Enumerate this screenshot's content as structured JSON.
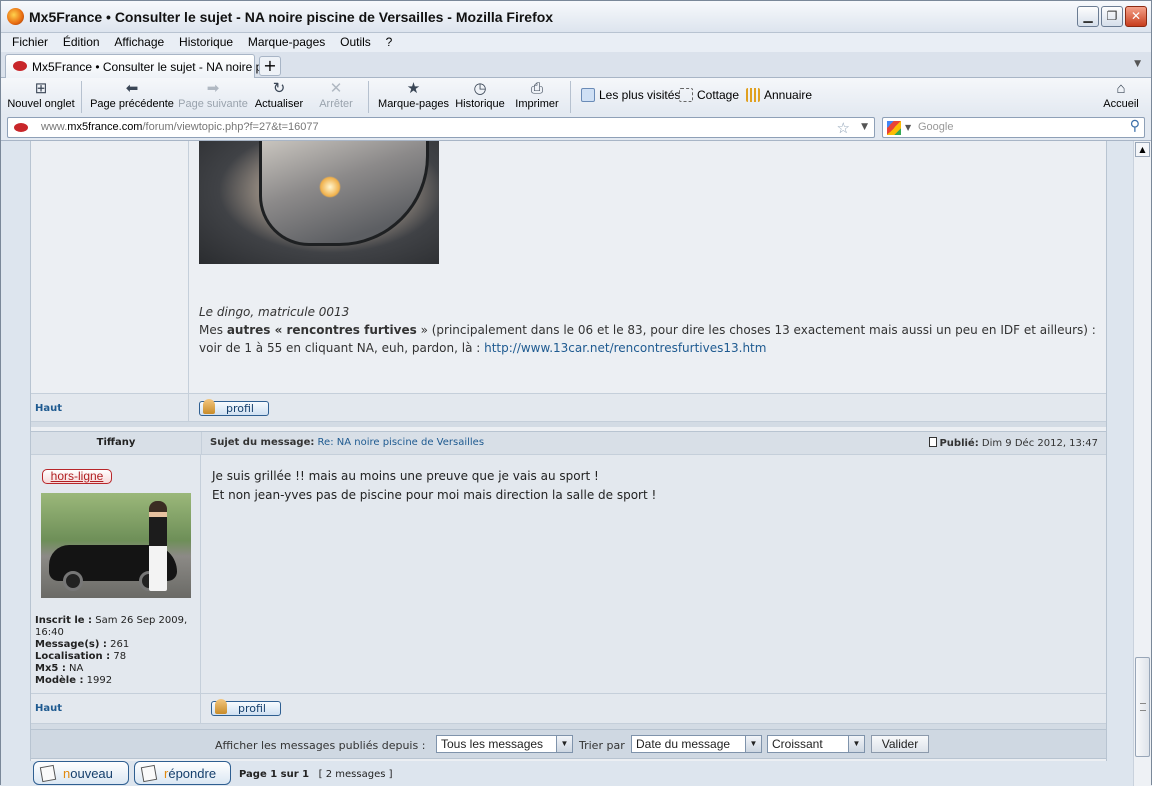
{
  "window": {
    "title": "Mx5France • Consulter le sujet - NA noire piscine de Versailles - Mozilla Firefox"
  },
  "menu": [
    "Fichier",
    "Édition",
    "Affichage",
    "Historique",
    "Marque-pages",
    "Outils",
    "?"
  ],
  "tab": {
    "label": "Mx5France • Consulter le sujet - NA noire pi..."
  },
  "nav": {
    "new_tab": "Nouvel onglet",
    "back": "Page précédente",
    "forward": "Page suivante",
    "reload": "Actualiser",
    "stop": "Arrêter",
    "bookmarks": "Marque-pages",
    "history": "Historique",
    "print": "Imprimer",
    "most_visited": "Les plus visités",
    "cottage": "Cottage",
    "annuaire": "Annuaire",
    "home": "Accueil"
  },
  "urlbar": {
    "prefix": "www.",
    "domain": "mx5france.com",
    "path": "/forum/viewtopic.php?f=27&t=16077"
  },
  "search": {
    "placeholder": "Google"
  },
  "post1": {
    "signature_name": "Le dingo, matricule 0013",
    "sig_prefix": "Mes ",
    "sig_bold": "autres « rencontres furtives",
    "sig_rest": " » (principalement dans le 06 et le 83, pour dire les choses 13 exactement mais aussi un peu en IDF et ailleurs) : voir de 1 à 55 en cliquant NA, euh, pardon, là : ",
    "sig_link": "http://www.13car.net/rencontresfurtives13.htm",
    "haut": "Haut",
    "profile": "profil"
  },
  "post2": {
    "author": "Tiffany",
    "subject_label": "Sujet du message:",
    "subject": "Re: NA noire piscine de Versailles",
    "published_label": "Publié:",
    "published_date": "Dim 9 Déc 2012, 13:47",
    "status": "hors-ligne",
    "registered_label": "Inscrit le :",
    "registered": "Sam 26 Sep 2009, 16:40",
    "messages_label": "Message(s) :",
    "messages": "261",
    "location_label": "Localisation :",
    "location": "78",
    "mx5_label": "Mx5 :",
    "mx5": "NA",
    "model_label": "Modèle :",
    "model": "1992",
    "line1": "Je suis grillée !! mais au moins une preuve que je vais au sport !",
    "line2": "Et non jean-yves pas de piscine pour moi mais direction la salle de sport !",
    "haut": "Haut",
    "profile": "profil"
  },
  "options": {
    "show_label": "Afficher les messages publiés depuis :",
    "show_value": "Tous les messages",
    "sort_label": "Trier par",
    "sort_value": "Date du message",
    "order_value": "Croissant",
    "submit": "Valider"
  },
  "actions": {
    "new_first": "n",
    "new_rest": "ouveau",
    "reply_first": "r",
    "reply_rest": "épondre",
    "page_label": "Page 1 sur 1",
    "count": "[ 2 messages ]"
  }
}
